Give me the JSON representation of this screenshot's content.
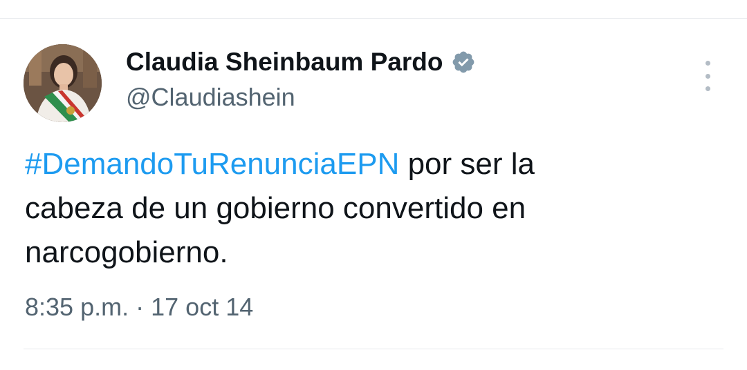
{
  "tweet": {
    "author": {
      "display_name": "Claudia Sheinbaum Pardo",
      "handle": "@Claudiashein",
      "verified": true,
      "verified_color": "#829aab"
    },
    "more_icon": "vertical-ellipsis-icon",
    "text": {
      "hashtag": "#DemandoTuRenunciaEPN",
      "line1_rest": " por ser la",
      "line2": "cabeza de un gobierno convertido en",
      "line3": "narcogobierno."
    },
    "meta": {
      "time": "8:35 p.m.",
      "separator": "·",
      "date": "17 oct 14"
    },
    "colors": {
      "hashtag": "#1d9bf0",
      "secondary_text": "#536471",
      "primary_text": "#0f1419"
    }
  }
}
